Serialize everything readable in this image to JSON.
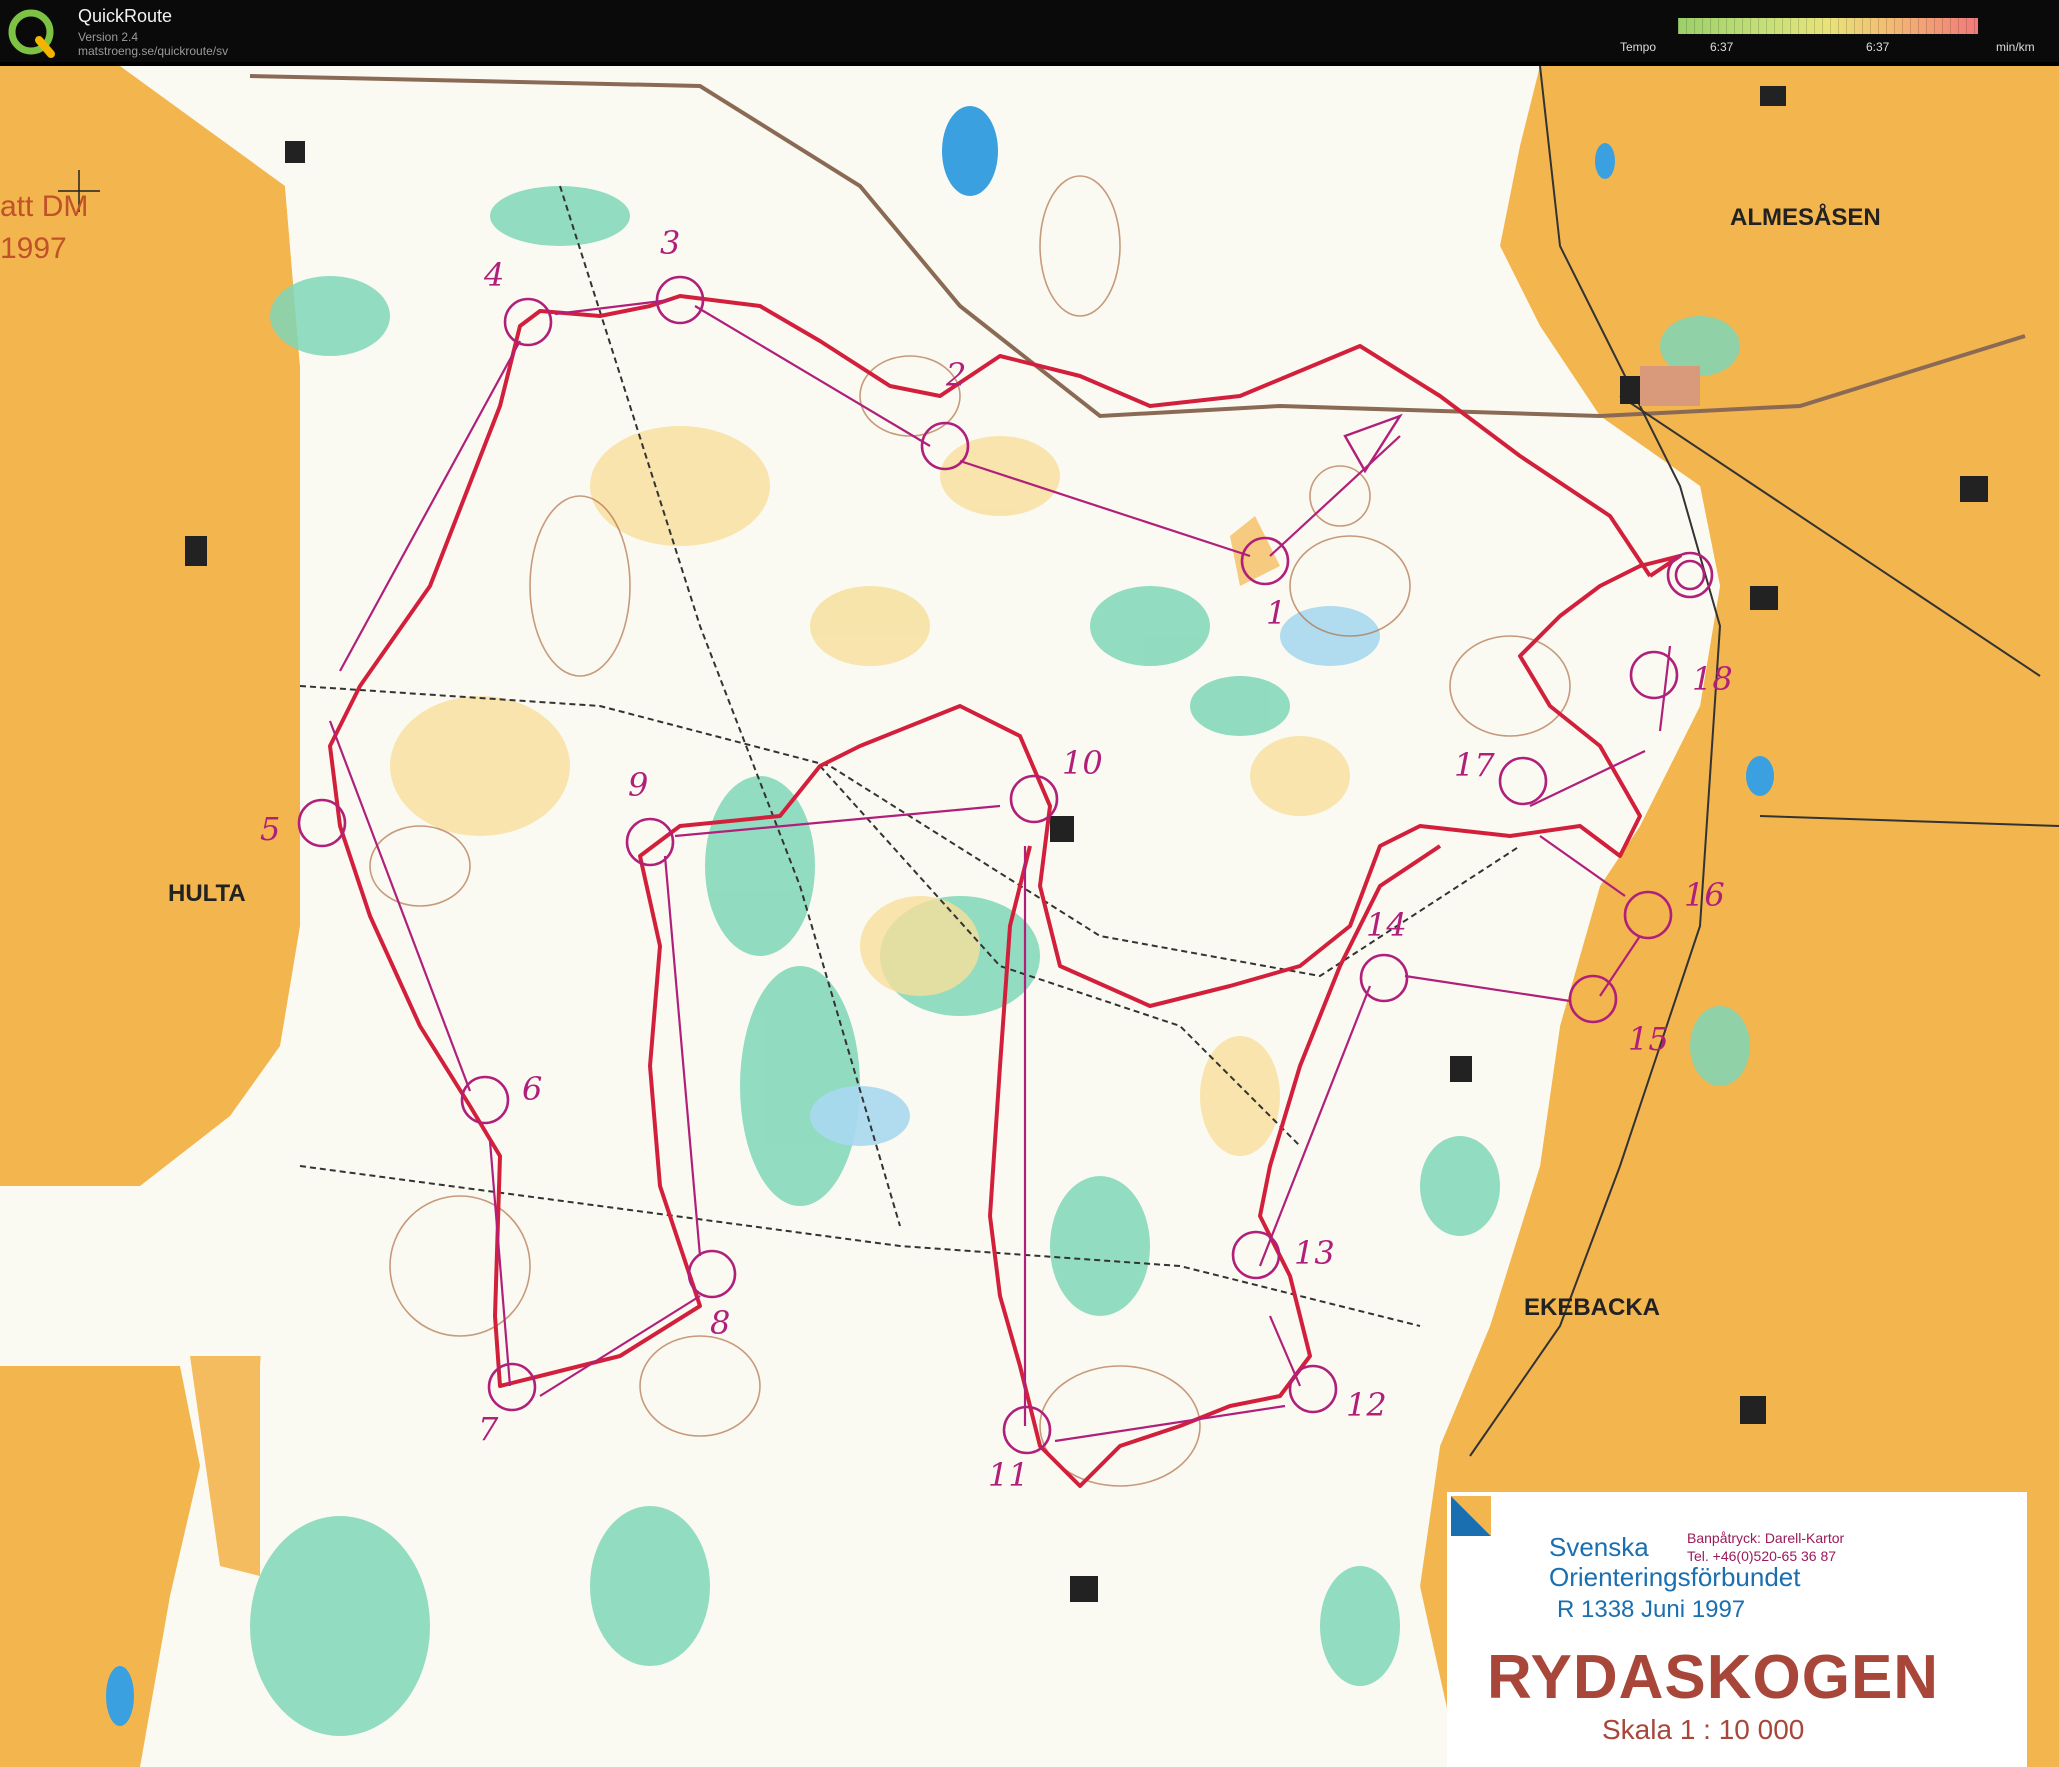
{
  "header": {
    "app_title": "QuickRoute",
    "version": "Version 2.4",
    "url": "matstroeng.se/quickroute/sv",
    "logo_icon": "quickroute-logo-icon",
    "tempo": {
      "label": "Tempo",
      "min_value": "6:37",
      "max_value": "6:37",
      "unit": "min/km",
      "gradient_colors": [
        "#9ccf6a",
        "#c7e07a",
        "#e8e37a",
        "#f2bc74",
        "#f07a7a"
      ]
    }
  },
  "map": {
    "colors": {
      "open_land": "#f3b54e",
      "forest": "#fbfaf2",
      "green": "#7fd6b8",
      "water": "#3aa0e0",
      "course": "#b0207a",
      "route": "#d2203c",
      "road": "#8a6a55"
    },
    "event_text": [
      "att DM",
      "1997"
    ],
    "place_names": {
      "almesasen": "ALMESÅSEN",
      "hulta": "HULTA",
      "ekebacka": "EKEBACKA"
    },
    "controls": [
      "1",
      "2",
      "3",
      "4",
      "5",
      "6",
      "7",
      "8",
      "9",
      "10",
      "11",
      "12",
      "13",
      "14",
      "15",
      "16",
      "17",
      "18"
    ],
    "info_box": {
      "org_line1": "Svenska",
      "org_line2": "Orienteringsförbundet",
      "print_line": "Banpåtryck: Darell-Kartor",
      "tel_line": "Tel. +46(0)520-65 36 87",
      "registration": "R   1338  Juni  1997",
      "map_name": "RYDASKOGEN",
      "scale": "Skala  1 : 10 000",
      "logo_icon": "sof-triangle-logo-icon"
    }
  }
}
